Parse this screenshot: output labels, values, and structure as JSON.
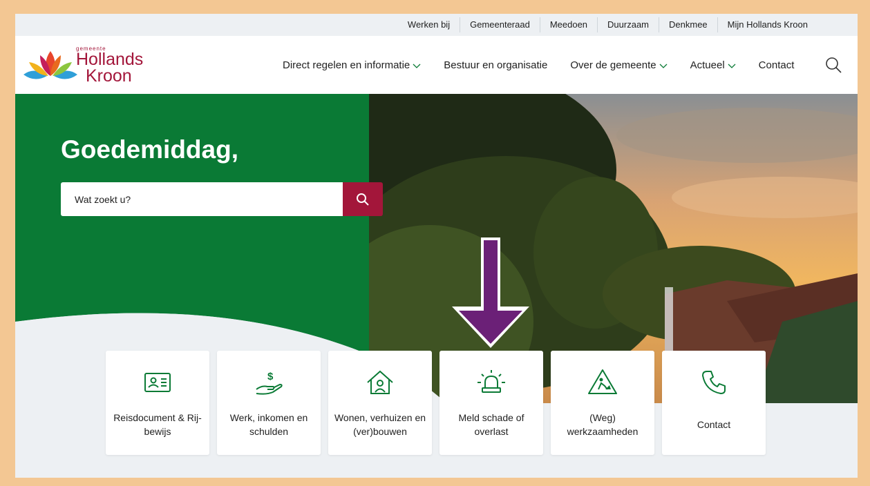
{
  "topbar": {
    "links": [
      "Werken bij",
      "Gemeenteraad",
      "Meedoen",
      "Duurzaam",
      "Denkmee",
      "Mijn Hollands Kroon"
    ]
  },
  "logo": {
    "small": "gemeente",
    "line1": "Hollands",
    "line2": "Kroon"
  },
  "nav": {
    "items": [
      {
        "label": "Direct regelen en informatie"
      },
      {
        "label": "Bestuur en organisatie"
      },
      {
        "label": "Over de gemeente"
      },
      {
        "label": "Actueel"
      },
      {
        "label": "Contact"
      }
    ]
  },
  "hero": {
    "greeting": "Goedemiddag,",
    "search_placeholder": "Wat zoekt u?"
  },
  "tiles": [
    {
      "label": "Reisdocument & Rij-bewijs",
      "icon": "id-card-icon"
    },
    {
      "label": "Werk, inkomen en schulden",
      "icon": "hand-dollar-icon"
    },
    {
      "label": "Wonen, verhuizen en (ver)bouwen",
      "icon": "house-person-icon"
    },
    {
      "label": "Meld schade of overlast",
      "icon": "siren-icon"
    },
    {
      "label": "(Weg) werkzaamheden",
      "icon": "roadwork-sign-icon"
    },
    {
      "label": "Contact",
      "icon": "phone-icon"
    }
  ],
  "colors": {
    "brand_red": "#a3163a",
    "hero_green": "#0a7a35",
    "icon_green": "#0a7a35",
    "arrow_purple": "#6b2077",
    "frame": "#f3c793"
  }
}
